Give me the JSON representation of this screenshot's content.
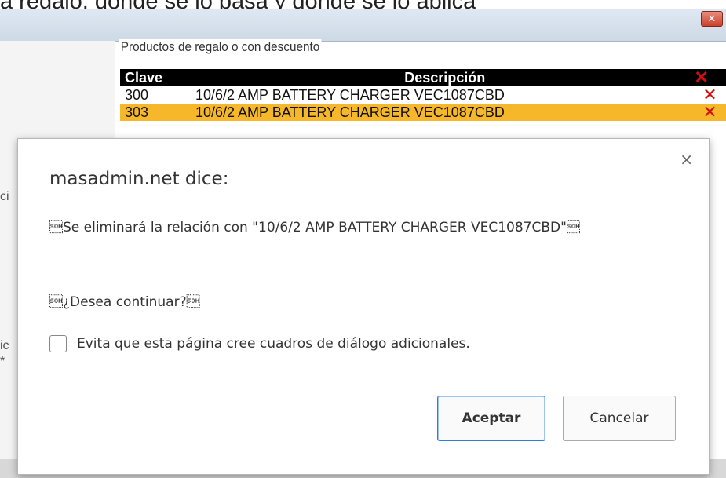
{
  "caption_fragment": "a regalo, donde se lo pasa y donde se lo aplica",
  "window": {
    "close_glyph": "✕"
  },
  "left_panel": {
    "fragment_1": "ci",
    "fragment_2": "ic",
    "fragment_3": "*"
  },
  "gift_panel": {
    "legend": "Productos de regalo o con descuento",
    "columns": {
      "clave": "Clave",
      "descripcion": "Descripción"
    },
    "header_delete_glyph": "✕",
    "rows": [
      {
        "clave": "300",
        "descripcion": "10/6/2 AMP BATTERY CHARGER VEC1087CBD",
        "delete_glyph": "✕",
        "highlighted": false
      },
      {
        "clave": "303",
        "descripcion": "10/6/2 AMP BATTERY CHARGER VEC1087CBD",
        "delete_glyph": "✕",
        "highlighted": true
      }
    ]
  },
  "dialog": {
    "close_glyph": "×",
    "title": "masadmin.net dice:",
    "message": "\u0001Se eliminará la relación con \"10/6/2 AMP BATTERY CHARGER VEC1087CBD\"\u0001",
    "question": "\u0001¿Desea continuar?\u0001",
    "suppress_label": "Evita que esta página cree cuadros de diálogo adicionales.",
    "suppress_checked": false,
    "accept_label": "Aceptar",
    "cancel_label": "Cancelar"
  },
  "colors": {
    "highlight_row": "#f6b82a",
    "delete_icon": "#d01010",
    "accent_button": "#2c7fd3"
  }
}
